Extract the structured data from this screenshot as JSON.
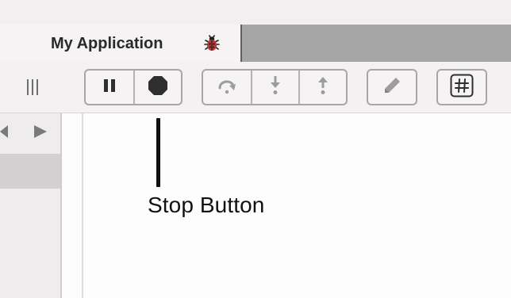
{
  "window": {
    "tab_title": "My Application",
    "tab_icon": "ladybug-icon"
  },
  "toolbar": {
    "grip_icon": "toolbar-grip-icon",
    "execution_controls": {
      "pause_icon": "pause-icon",
      "stop_icon": "stop-icon"
    },
    "step_controls": {
      "step_over_icon": "step-over-icon",
      "step_into_icon": "step-into-icon",
      "step_out_icon": "step-out-icon"
    },
    "edit_icon": "pencil-icon",
    "hash_icon": "hash-icon"
  },
  "sidebar": {
    "nav_back_icon": "triangle-left-icon",
    "nav_forward_icon": "triangle-right-icon"
  },
  "annotation": {
    "label": "Stop Button"
  },
  "colors": {
    "tabbar_inactive": "#a6a6a6",
    "toolbar_bg": "#f4f1f2",
    "button_border": "#a7a7a7",
    "icon_active": "#2f2f2f",
    "icon_disabled": "#9c9c9c",
    "sidebar_bg": "#efecee",
    "sidebar_selected": "#d3d0d1",
    "callout": "#111111"
  }
}
